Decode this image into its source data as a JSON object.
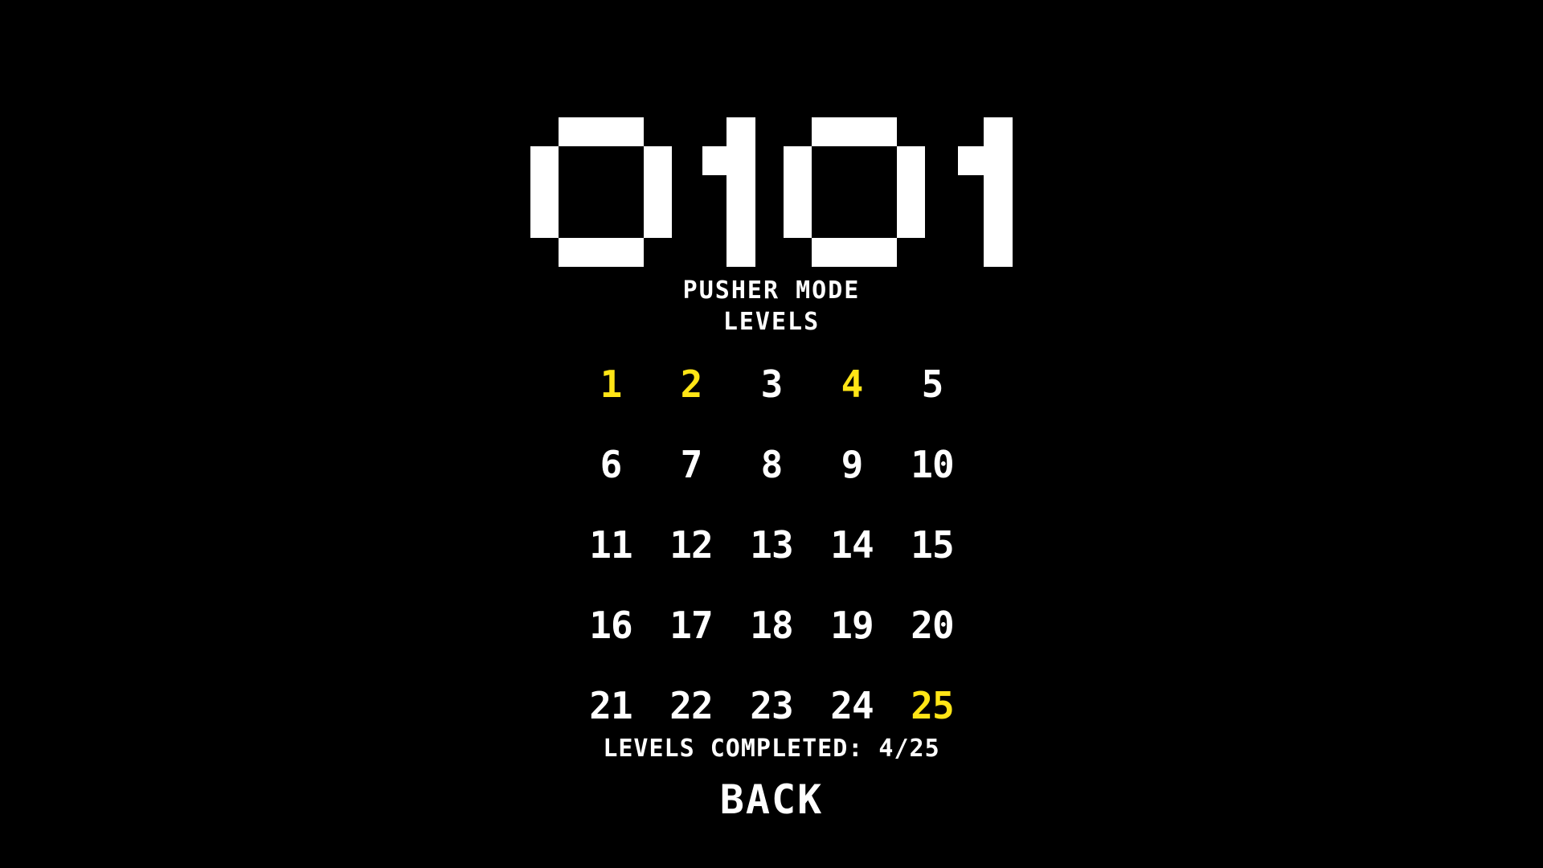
{
  "game": {
    "title": "0101",
    "mode_label": "PUSHER MODE",
    "levels_label": "LEVELS"
  },
  "colors": {
    "background": "#000000",
    "text": "#ffffff",
    "completed": "#ffe516"
  },
  "levels": [
    {
      "label": "1",
      "completed": true
    },
    {
      "label": "2",
      "completed": true
    },
    {
      "label": "3",
      "completed": false
    },
    {
      "label": "4",
      "completed": true
    },
    {
      "label": "5",
      "completed": false
    },
    {
      "label": "6",
      "completed": false
    },
    {
      "label": "7",
      "completed": false
    },
    {
      "label": "8",
      "completed": false
    },
    {
      "label": "9",
      "completed": false
    },
    {
      "label": "10",
      "completed": false
    },
    {
      "label": "11",
      "completed": false
    },
    {
      "label": "12",
      "completed": false
    },
    {
      "label": "13",
      "completed": false
    },
    {
      "label": "14",
      "completed": false
    },
    {
      "label": "15",
      "completed": false
    },
    {
      "label": "16",
      "completed": false
    },
    {
      "label": "17",
      "completed": false
    },
    {
      "label": "18",
      "completed": false
    },
    {
      "label": "19",
      "completed": false
    },
    {
      "label": "20",
      "completed": false
    },
    {
      "label": "21",
      "completed": false
    },
    {
      "label": "22",
      "completed": false
    },
    {
      "label": "23",
      "completed": false
    },
    {
      "label": "24",
      "completed": false
    },
    {
      "label": "25",
      "completed": true
    }
  ],
  "progress": {
    "text": "LEVELS COMPLETED: 4/25"
  },
  "back_label": "BACK"
}
